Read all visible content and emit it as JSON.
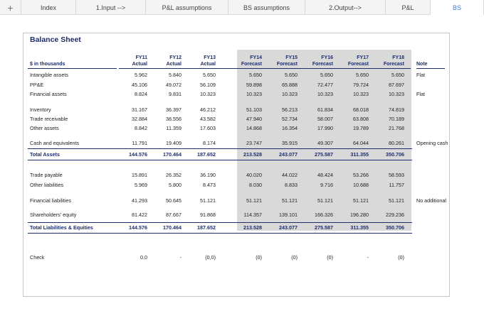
{
  "tabs": [
    {
      "label": "Index"
    },
    {
      "label": "1.Input -->"
    },
    {
      "label": "P&L assumptions"
    },
    {
      "label": "BS assumptions"
    },
    {
      "label": "2.Output-->"
    },
    {
      "label": "P&L"
    },
    {
      "label": "BS"
    }
  ],
  "tab_add_icon": "+",
  "colors": {
    "accent": "#3b7ddd",
    "title": "#1c2d6b",
    "forecast_shade": "#d9d9d9"
  },
  "sheet": {
    "title": "Balance Sheet",
    "unit_label": "$ in thousands",
    "note_header": "Note",
    "columns": [
      {
        "year": "FY11",
        "type": "Actual"
      },
      {
        "year": "FY12",
        "type": "Actual"
      },
      {
        "year": "FY13",
        "type": "Actual"
      },
      {
        "year": "FY14",
        "type": "Forecast"
      },
      {
        "year": "FY15",
        "type": "Forecast"
      },
      {
        "year": "FY16",
        "type": "Forecast"
      },
      {
        "year": "FY17",
        "type": "Forecast"
      },
      {
        "year": "FY18",
        "type": "Forecast"
      }
    ],
    "rows": {
      "intangible": {
        "label": "Intangible assets",
        "values": [
          "5.962",
          "5.840",
          "5.650",
          "5.650",
          "5.650",
          "5.650",
          "5.650",
          "5.650"
        ],
        "note": "Flat"
      },
      "ppe": {
        "label": "PP&E",
        "values": [
          "45.106",
          "49.072",
          "56.109",
          "59.898",
          "65.888",
          "72.477",
          "79.724",
          "87.697"
        ],
        "note": ""
      },
      "fin_assets": {
        "label": "Financial assets",
        "values": [
          "8.824",
          "9.831",
          "10.323",
          "10.323",
          "10.323",
          "10.323",
          "10.323",
          "10.323"
        ],
        "note": "Flat"
      },
      "inventory": {
        "label": "Inventory",
        "values": [
          "31.167",
          "36.397",
          "46.212",
          "51.103",
          "56.213",
          "61.834",
          "68.018",
          "74.819"
        ],
        "note": ""
      },
      "trade_rec": {
        "label": "Trade receivable",
        "values": [
          "32.884",
          "38.556",
          "43.582",
          "47.940",
          "52.734",
          "58.007",
          "63.808",
          "70.189"
        ],
        "note": ""
      },
      "other_assets": {
        "label": "Other assets",
        "values": [
          "8.842",
          "11.359",
          "17.603",
          "14.868",
          "16.354",
          "17.990",
          "19.789",
          "21.768"
        ],
        "note": ""
      },
      "cash": {
        "label": "Cash and equivalents",
        "values": [
          "11.791",
          "19.409",
          "8.174",
          "23.747",
          "35.915",
          "49.307",
          "64.044",
          "80.261"
        ],
        "note": "Opening cash"
      },
      "total_assets": {
        "label": "Total Assets",
        "values": [
          "144.576",
          "170.464",
          "187.652",
          "213.528",
          "243.077",
          "275.587",
          "311.355",
          "350.706"
        ],
        "note": ""
      },
      "trade_pay": {
        "label": "Trade payable",
        "values": [
          "15.891",
          "26.352",
          "36.190",
          "40.020",
          "44.022",
          "48.424",
          "53.266",
          "58.593"
        ],
        "note": ""
      },
      "other_liab": {
        "label": "Other liabilities",
        "values": [
          "5.969",
          "5.800",
          "8.473",
          "8.030",
          "8.833",
          "9.716",
          "10.688",
          "11.757"
        ],
        "note": ""
      },
      "fin_liab": {
        "label": "Financial liabilities",
        "values": [
          "41.293",
          "50.645",
          "51.121",
          "51.121",
          "51.121",
          "51.121",
          "51.121",
          "51.121"
        ],
        "note": "No additional"
      },
      "equity": {
        "label": "Shareholders' equity",
        "values": [
          "81.422",
          "87.667",
          "91.868",
          "114.357",
          "139.101",
          "166.326",
          "196.280",
          "229.236"
        ],
        "note": ""
      },
      "total_le": {
        "label": "Total Liabilities & Equities",
        "values": [
          "144.576",
          "170.464",
          "187.652",
          "213.528",
          "243.077",
          "275.587",
          "311.355",
          "350.706"
        ],
        "note": ""
      },
      "check": {
        "label": "Check",
        "values": [
          "0,0",
          "-",
          "(0,0)",
          "(0)",
          "(0)",
          "(0)",
          "-",
          "(0)"
        ],
        "note": ""
      }
    }
  }
}
